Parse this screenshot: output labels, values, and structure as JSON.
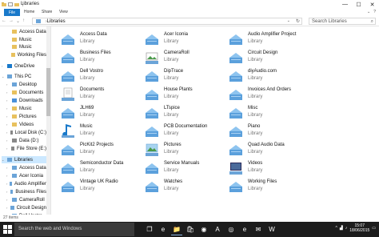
{
  "window": {
    "title": "Libraries",
    "controls": {
      "minimize": "—",
      "maximize": "☐",
      "close": "✕"
    }
  },
  "ribbon": {
    "tabs": [
      "File",
      "Home",
      "Share",
      "View"
    ],
    "right": {
      "expand": "⌄",
      "help": "?"
    }
  },
  "address": {
    "path": "Libraries",
    "search_placeholder": "Search Libraries",
    "back": "←",
    "forward": "→",
    "dropdown": "⌄",
    "up": "↑",
    "refresh": "↻",
    "path_dropdown": "⌄"
  },
  "nav": {
    "items": [
      {
        "label": "Access Data",
        "icon": "folder-icon",
        "indent": 1,
        "chev": "",
        "color": "#e8c15e"
      },
      {
        "label": "Music",
        "icon": "music-folder-icon",
        "indent": 1,
        "chev": "",
        "color": "#e8c15e"
      },
      {
        "label": "Music",
        "icon": "music-folder-icon",
        "indent": 1,
        "chev": "",
        "color": "#e8c15e"
      },
      {
        "label": "Working Files",
        "icon": "folder-icon",
        "indent": 1,
        "chev": "",
        "color": "#e8c15e"
      },
      {
        "label": "OneDrive",
        "icon": "onedrive-icon",
        "indent": 0,
        "chev": "›",
        "color": "#1979ca"
      },
      {
        "label": "This PC",
        "icon": "computer-icon",
        "indent": 0,
        "chev": "⌄",
        "color": "#6ba4d8"
      },
      {
        "label": "Desktop",
        "icon": "desktop-folder-icon",
        "indent": 1,
        "chev": "›",
        "color": "#6ba4d8"
      },
      {
        "label": "Documents",
        "icon": "documents-folder-icon",
        "indent": 1,
        "chev": "›",
        "color": "#e8c15e"
      },
      {
        "label": "Downloads",
        "icon": "downloads-folder-icon",
        "indent": 1,
        "chev": "›",
        "color": "#4a90d9"
      },
      {
        "label": "Music",
        "icon": "music-folder-icon",
        "indent": 1,
        "chev": "›",
        "color": "#e8c15e"
      },
      {
        "label": "Pictures",
        "icon": "pictures-folder-icon",
        "indent": 1,
        "chev": "›",
        "color": "#e8c15e"
      },
      {
        "label": "Videos",
        "icon": "videos-folder-icon",
        "indent": 1,
        "chev": "›",
        "color": "#e8c15e"
      },
      {
        "label": "Local Disk (C:)",
        "icon": "drive-icon",
        "indent": 1,
        "chev": "›",
        "color": "#888888"
      },
      {
        "label": "Data (D:)",
        "icon": "drive-icon",
        "indent": 1,
        "chev": "›",
        "color": "#888888"
      },
      {
        "label": "File Store (E:)",
        "icon": "drive-icon",
        "indent": 1,
        "chev": "›",
        "color": "#888888"
      },
      {
        "label": "Libraries",
        "icon": "libraries-icon",
        "indent": 0,
        "chev": "⌄",
        "color": "#6ba4d8",
        "selected": true
      },
      {
        "label": "Access Data",
        "icon": "library-icon",
        "indent": 1,
        "chev": "›",
        "color": "#6ba4d8"
      },
      {
        "label": "Acer Iconia",
        "icon": "library-icon",
        "indent": 1,
        "chev": "›",
        "color": "#6ba4d8"
      },
      {
        "label": "Audio Amplifier",
        "icon": "library-icon",
        "indent": 1,
        "chev": "›",
        "color": "#6ba4d8"
      },
      {
        "label": "Business Files",
        "icon": "library-icon",
        "indent": 1,
        "chev": "›",
        "color": "#6ba4d8"
      },
      {
        "label": "CameraRoll",
        "icon": "library-icon",
        "indent": 1,
        "chev": "›",
        "color": "#6ba4d8"
      },
      {
        "label": "Circuit Design",
        "icon": "library-icon",
        "indent": 1,
        "chev": "›",
        "color": "#6ba4d8"
      },
      {
        "label": "Dell Vostro",
        "icon": "library-icon",
        "indent": 1,
        "chev": "›",
        "color": "#6ba4d8"
      }
    ]
  },
  "libraries": [
    {
      "name": "Access Data",
      "type": "Library",
      "icon": "library-icon"
    },
    {
      "name": "Acer Iconia",
      "type": "Library",
      "icon": "library-icon"
    },
    {
      "name": "Audio Amplifier Project",
      "type": "Library",
      "icon": "library-icon"
    },
    {
      "name": "Business Files",
      "type": "Library",
      "icon": "library-icon"
    },
    {
      "name": "CameraRoll",
      "type": "Library",
      "icon": "camera-roll-library-icon"
    },
    {
      "name": "Circuit Design",
      "type": "Library",
      "icon": "library-icon"
    },
    {
      "name": "Dell Vostro",
      "type": "Library",
      "icon": "library-icon"
    },
    {
      "name": "DipTrace",
      "type": "Library",
      "icon": "library-icon"
    },
    {
      "name": "diyAudio.com",
      "type": "Library",
      "icon": "library-icon"
    },
    {
      "name": "Documents",
      "type": "Library",
      "icon": "documents-library-icon"
    },
    {
      "name": "House Plants",
      "type": "Library",
      "icon": "library-icon"
    },
    {
      "name": "Invoices And Orders",
      "type": "Library",
      "icon": "library-icon"
    },
    {
      "name": "JLH69",
      "type": "Library",
      "icon": "library-icon"
    },
    {
      "name": "LTspice",
      "type": "Library",
      "icon": "library-icon"
    },
    {
      "name": "Misc",
      "type": "Library",
      "icon": "library-icon"
    },
    {
      "name": "Music",
      "type": "Library",
      "icon": "music-library-icon"
    },
    {
      "name": "PCB Documentation",
      "type": "Library",
      "icon": "library-icon"
    },
    {
      "name": "Piano",
      "type": "Library",
      "icon": "library-icon"
    },
    {
      "name": "PicKit2 Projects",
      "type": "Library",
      "icon": "library-icon"
    },
    {
      "name": "Pictures",
      "type": "Library",
      "icon": "pictures-library-icon"
    },
    {
      "name": "Quad Audio Data",
      "type": "Library",
      "icon": "library-icon"
    },
    {
      "name": "Semiconductor Data",
      "type": "Library",
      "icon": "library-icon"
    },
    {
      "name": "Service Manuals",
      "type": "Library",
      "icon": "library-icon"
    },
    {
      "name": "Videos",
      "type": "Library",
      "icon": "videos-library-icon"
    },
    {
      "name": "Vintage UK Radio",
      "type": "Library",
      "icon": "library-icon"
    },
    {
      "name": "Watches",
      "type": "Library",
      "icon": "library-icon"
    },
    {
      "name": "Working Files",
      "type": "Library",
      "icon": "library-icon"
    }
  ],
  "status": {
    "items_count": "27 items"
  },
  "taskbar": {
    "search_placeholder": "Search the web and Windows",
    "apps": [
      {
        "icon": "task-view-icon",
        "glyph": "❐",
        "active": false
      },
      {
        "icon": "edge-icon",
        "glyph": "e",
        "active": false
      },
      {
        "icon": "file-explorer-icon",
        "glyph": "📁",
        "active": true
      },
      {
        "icon": "store-icon",
        "glyph": "🛍",
        "active": false
      },
      {
        "icon": "media-player-icon",
        "glyph": "◉",
        "active": false
      },
      {
        "icon": "pdf-reader-icon",
        "glyph": "A",
        "active": false
      },
      {
        "icon": "chrome-icon",
        "glyph": "◎",
        "active": false
      },
      {
        "icon": "internet-explorer-icon",
        "glyph": "e",
        "active": false
      },
      {
        "icon": "outlook-icon",
        "glyph": "✉",
        "active": false
      },
      {
        "icon": "word-icon",
        "glyph": "W",
        "active": false
      }
    ],
    "clock_time": "15:07",
    "clock_date": "18/06/2015",
    "tray": {
      "chevron": "^",
      "network": "▟",
      "volume": "♪",
      "notification": "▭"
    }
  },
  "colors": {
    "accent": "#1979ca",
    "selected_bg": "#cce8ff",
    "taskbar": "#1c1c1c"
  }
}
